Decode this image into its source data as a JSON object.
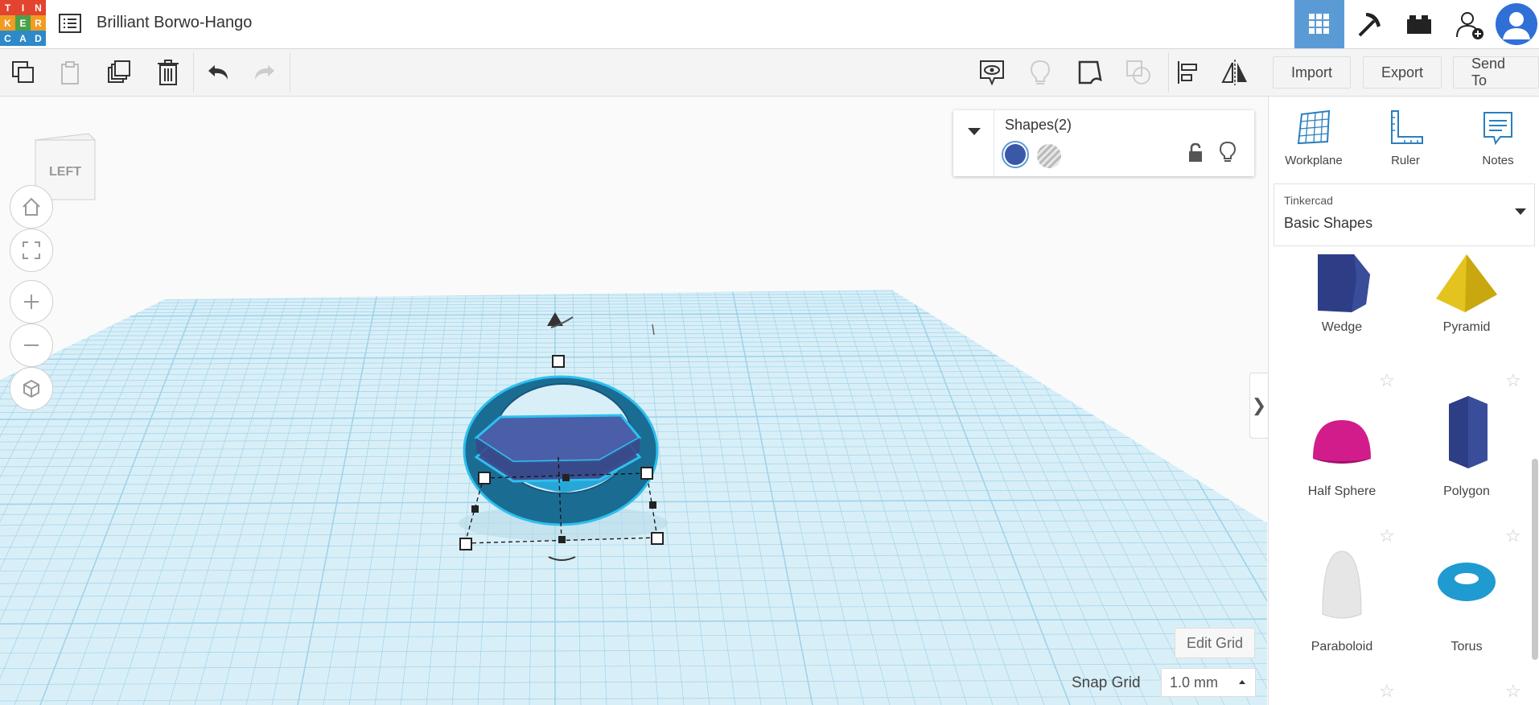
{
  "app": {
    "title": "Brilliant Borwo-Hango",
    "logo_letters": [
      "T",
      "I",
      "N",
      "K",
      "E",
      "R",
      "C",
      "A",
      "D"
    ],
    "logo_colors": [
      "#e2442f",
      "#e2442f",
      "#e2442f",
      "#f29b22",
      "#4aa14a",
      "#f29b22",
      "#2d89c8",
      "#2d89c8",
      "#2d89c8"
    ]
  },
  "topbar": {
    "icons": [
      "grid-view-icon",
      "pickaxe-icon",
      "bricks-icon",
      "add-user-icon",
      "profile-avatar-icon"
    ]
  },
  "toolbar": {
    "import_label": "Import",
    "export_label": "Export",
    "send_to_label": "Send To"
  },
  "viewcube": {
    "face_label": "LEFT"
  },
  "shapes_panel": {
    "title": "Shapes(2)",
    "solid_color": "#3a58a8"
  },
  "canvas": {
    "edit_grid_label": "Edit Grid",
    "snap_grid_label": "Snap Grid",
    "snap_grid_value": "1.0 mm"
  },
  "right_panel": {
    "tools": [
      {
        "label": "Workplane",
        "icon": "workplane-icon"
      },
      {
        "label": "Ruler",
        "icon": "ruler-icon"
      },
      {
        "label": "Notes",
        "icon": "notes-icon"
      }
    ],
    "library_caption": "Tinkercad",
    "library_value": "Basic Shapes",
    "shapes": [
      {
        "name": "Wedge"
      },
      {
        "name": "Pyramid"
      },
      {
        "name": "Half Sphere"
      },
      {
        "name": "Polygon"
      },
      {
        "name": "Paraboloid"
      },
      {
        "name": "Torus"
      }
    ]
  },
  "colors": {
    "accent": "#5b9bd5",
    "grid": "#aadbee",
    "ring": "#1f9bd1",
    "hexagon": "#4a5fa8"
  }
}
